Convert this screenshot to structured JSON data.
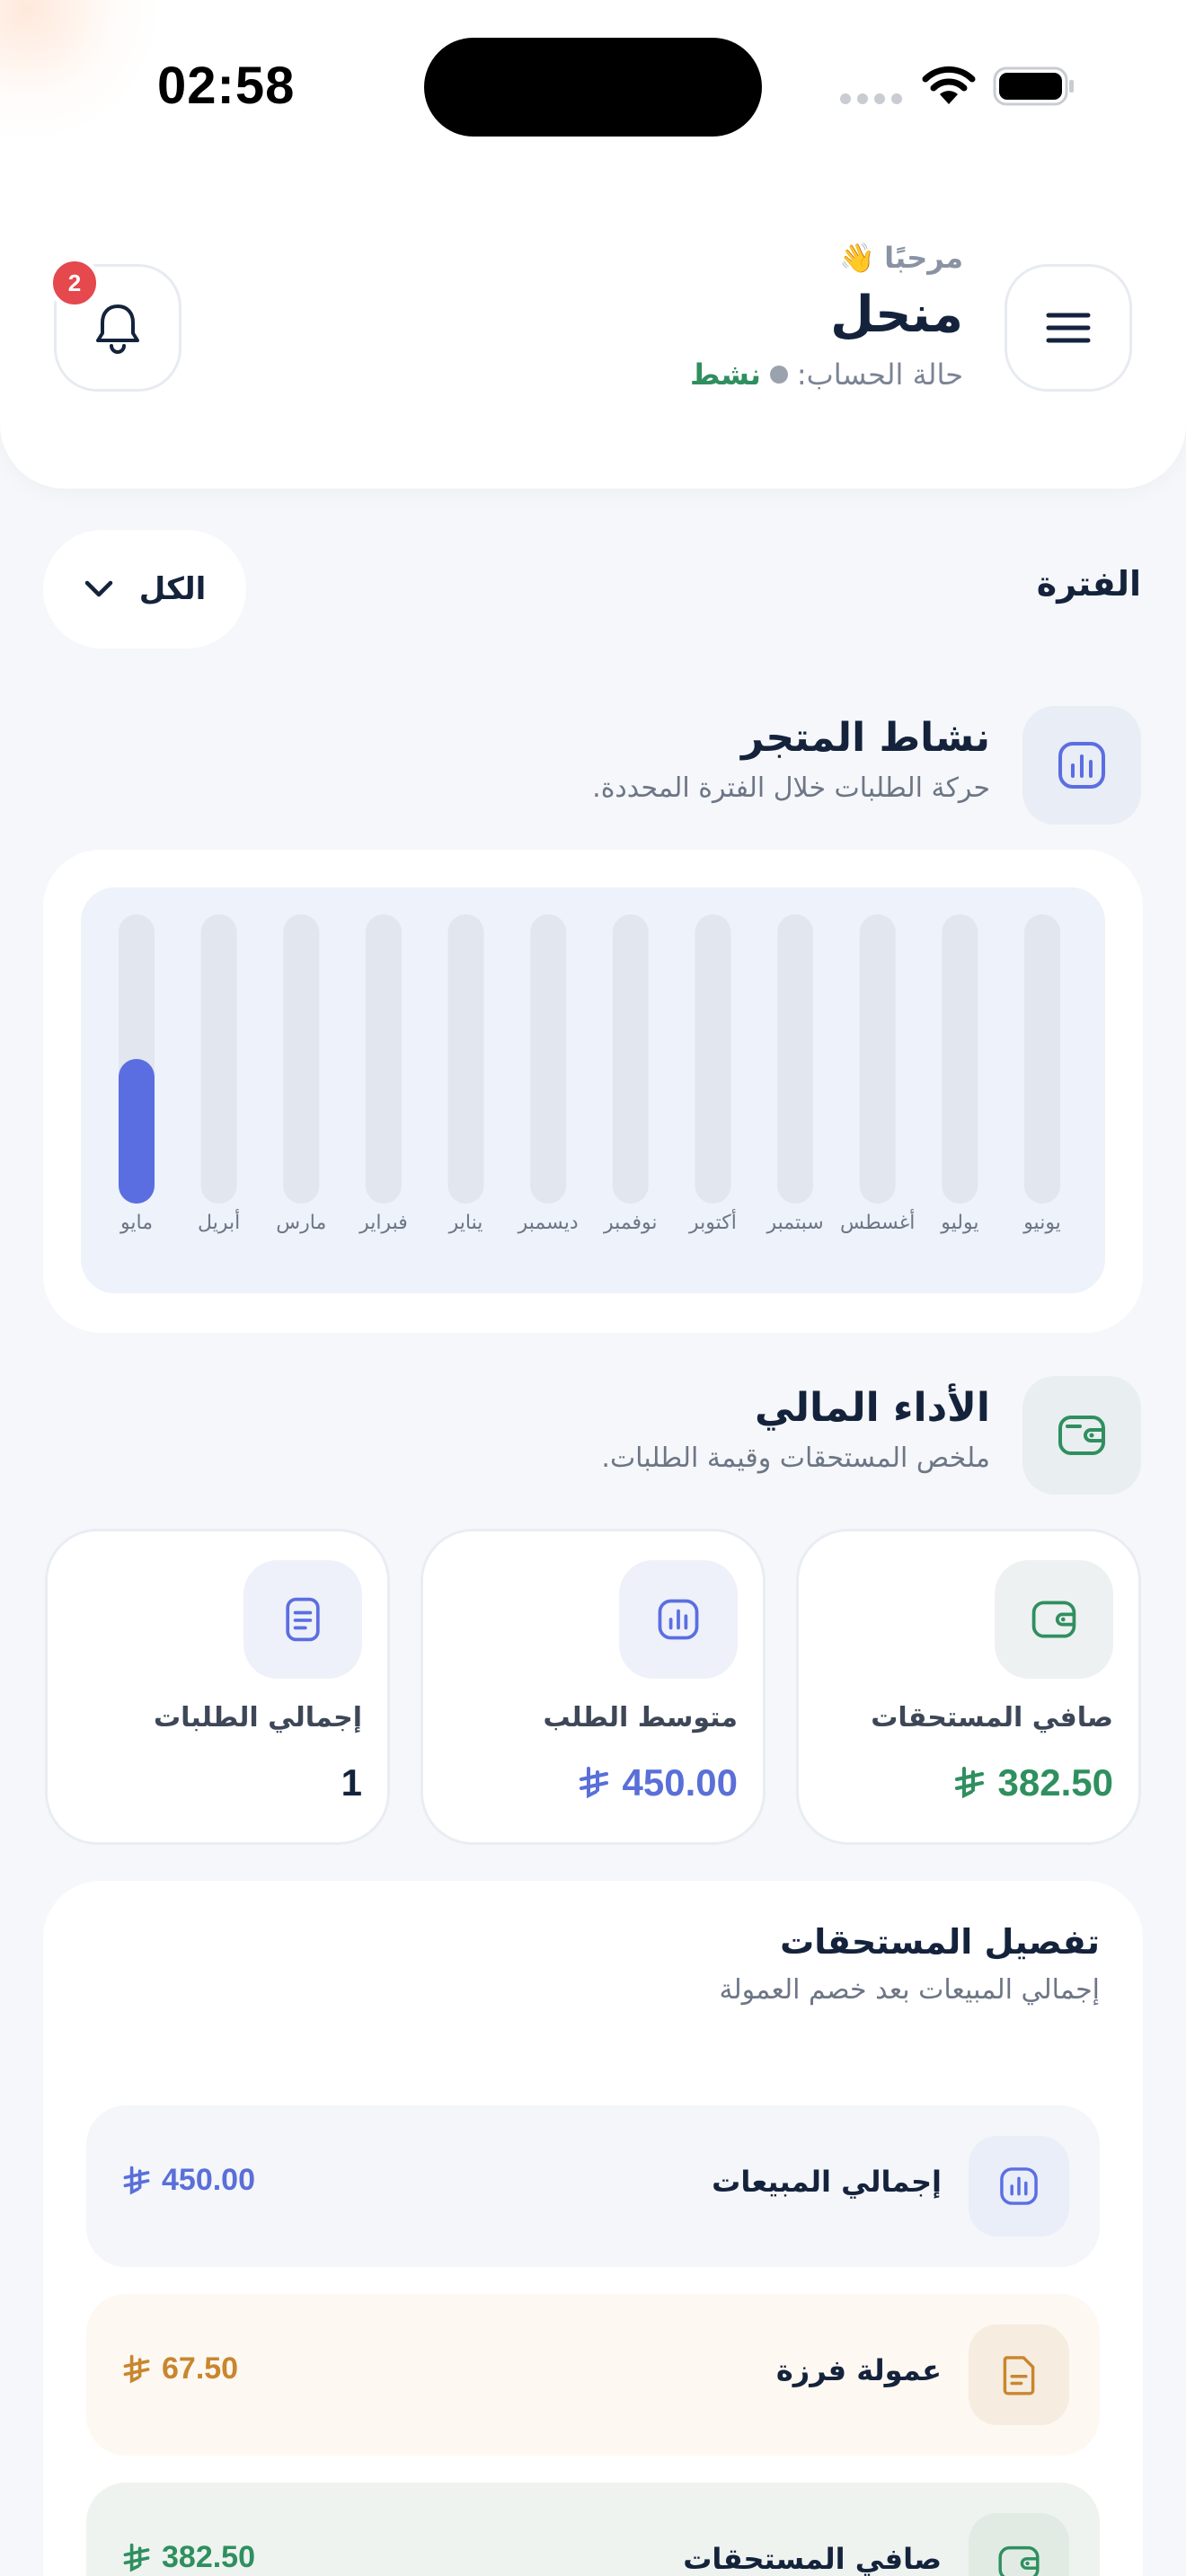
{
  "status_bar": {
    "time": "02:58"
  },
  "header": {
    "greeting": "مرحبًا",
    "wave_emoji": "👋",
    "user_name": "منحل",
    "account_status_label": "حالة الحساب:",
    "account_status_value": "نشط",
    "notification_count": "2"
  },
  "period": {
    "label": "الفترة",
    "selected": "الكل"
  },
  "store_activity": {
    "title": "نشاط المتجر",
    "subtitle": "حركة الطلبات خلال الفترة المحددة."
  },
  "chart_data": {
    "type": "bar",
    "categories": [
      "يونيو",
      "يوليو",
      "أغسطس",
      "سبتمبر",
      "أكتوبر",
      "نوفمبر",
      "ديسمبر",
      "يناير",
      "فبراير",
      "مارس",
      "أبريل",
      "مايو"
    ],
    "values": [
      0,
      0,
      0,
      0,
      0,
      0,
      0,
      0,
      0,
      0,
      0,
      1
    ],
    "ylim": [
      0,
      2
    ],
    "colors": {
      "bar": "#5b6ee1",
      "track": "#e1e6ef"
    }
  },
  "financial": {
    "title": "الأداء المالي",
    "subtitle": "ملخص المستحقات وقيمة الطلبات."
  },
  "stats": [
    {
      "label": "صافي المستحقات",
      "value": "382.50",
      "icon": "wallet-icon",
      "color": "#2f8f5f"
    },
    {
      "label": "متوسط الطلب",
      "value": "450.00",
      "icon": "chart-icon",
      "color": "#5a6fd8"
    },
    {
      "label": "إجمالي الطلبات",
      "value": "1",
      "icon": "document-icon",
      "color": "#14233b"
    }
  ],
  "breakdown": {
    "title": "تفصيل المستحقات",
    "subtitle": "إجمالي المبيعات بعد خصم العمولة",
    "rows": [
      {
        "label": "إجمالي المبيعات",
        "value": "450.00",
        "icon": "chart-icon"
      },
      {
        "label": "عمولة فرزة",
        "value": "67.50",
        "icon": "document-icon"
      },
      {
        "label": "صافي المستحقات",
        "value": "382.50",
        "icon": "wallet-icon"
      }
    ]
  },
  "colors": {
    "accent_blue": "#5b6ee1",
    "accent_green": "#2f8f5f",
    "accent_orange": "#c9862e",
    "badge_red": "#e5484d"
  }
}
